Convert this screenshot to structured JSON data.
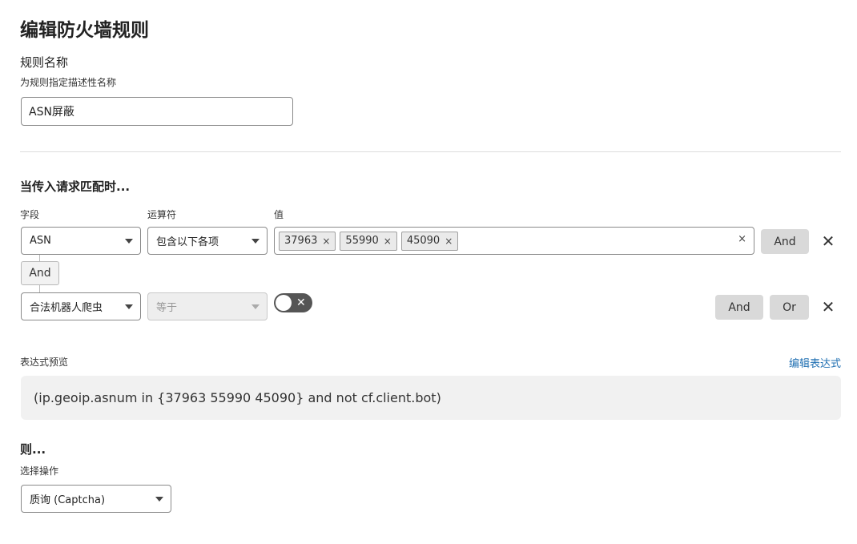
{
  "page": {
    "title": "编辑防火墙规则"
  },
  "rule_name": {
    "label": "规则名称",
    "help": "为规则指定描述性名称",
    "value": "ASN屏蔽"
  },
  "match": {
    "heading": "当传入请求匹配时...",
    "col_field": "字段",
    "col_operator": "运算符",
    "col_value": "值",
    "row1": {
      "field": "ASN",
      "operator": "包含以下各项",
      "values": [
        "37963",
        "55990",
        "45090"
      ],
      "clear_icon": "×",
      "and_label": "And"
    },
    "connector_label": "And",
    "row2": {
      "field": "合法机器人爬虫",
      "operator": "等于",
      "toggle_icon": "✕",
      "and_label": "And",
      "or_label": "Or"
    },
    "remove_icon": "✕"
  },
  "expression": {
    "label": "表达式预览",
    "edit_link": "编辑表达式",
    "text": "(ip.geoip.asnum in {37963 55990 45090} and not cf.client.bot)"
  },
  "then": {
    "heading": "则...",
    "label": "选择操作",
    "action": "质询 (Captcha)"
  }
}
